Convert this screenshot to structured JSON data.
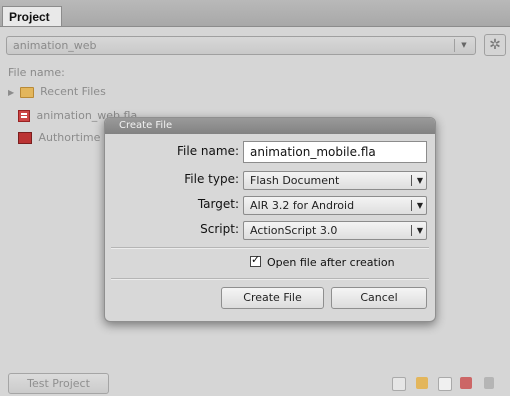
{
  "panel": {
    "tab_label": "Project"
  },
  "project_select": {
    "value": "animation_web"
  },
  "file_name_label": "File name:",
  "tree": {
    "recent_files": "Recent Files",
    "file_item": "animation_web.fla",
    "authortime_item": "Authortime"
  },
  "dialog": {
    "title": "Create File",
    "file_name": {
      "label": "File name:",
      "value": "animation_mobile.fla"
    },
    "file_type": {
      "label": "File type:",
      "selected": "Flash Document"
    },
    "target": {
      "label": "Target:",
      "selected": "AIR 3.2 for Android"
    },
    "script": {
      "label": "Script:",
      "selected": "ActionScript 3.0"
    },
    "open_after": {
      "label": "Open file after creation",
      "checked": true
    },
    "create_button": "Create File",
    "cancel_button": "Cancel"
  },
  "bottom": {
    "test_button": "Test Project",
    "icons": [
      "new-file-icon",
      "folder-icon",
      "document-icon",
      "fla-icon",
      "trash-icon"
    ]
  },
  "colors": {
    "dialog_title_bar": "#8c8c8c",
    "panel_background": "#d6d6d6",
    "fla_icon": "#cc4444"
  }
}
